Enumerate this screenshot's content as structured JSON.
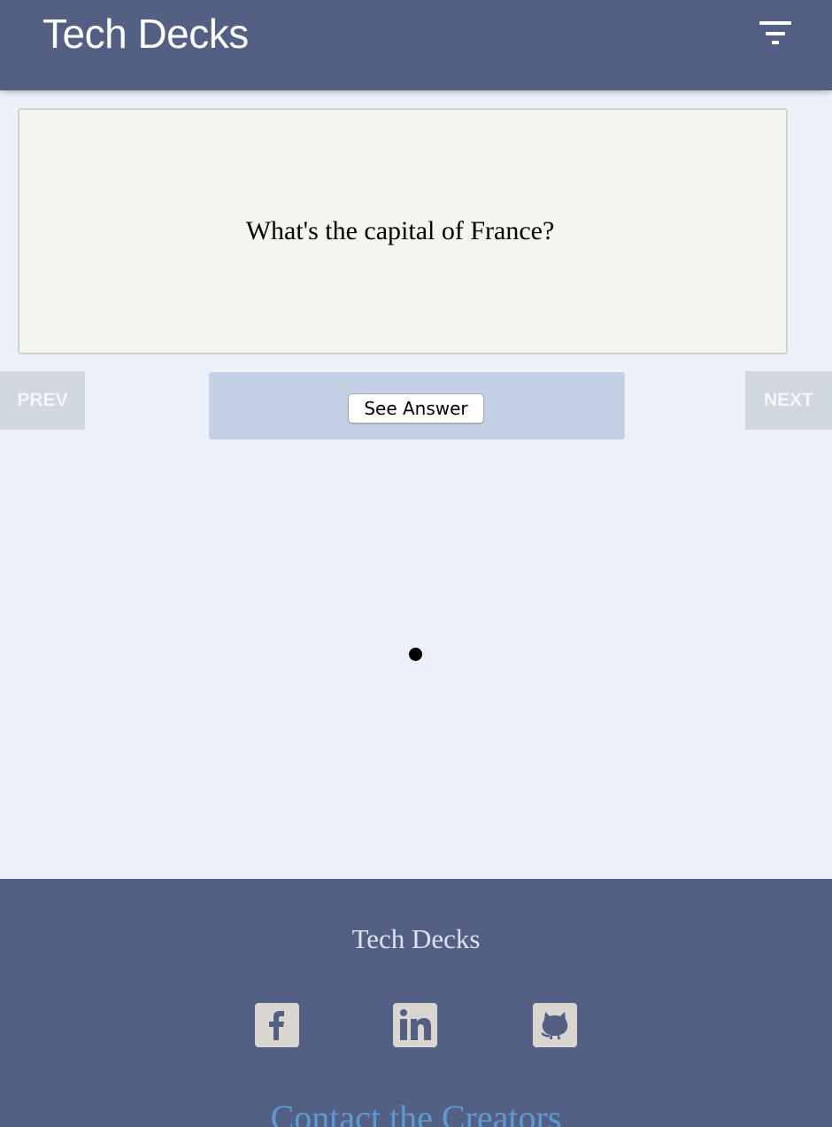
{
  "header": {
    "brand": "Tech Decks",
    "filter_icon": "filter-lines-icon"
  },
  "card": {
    "question": "What's the capital of France?"
  },
  "navigation": {
    "prev_label": "PREV",
    "next_label": "NEXT"
  },
  "answer": {
    "button_label": "See Answer"
  },
  "footer": {
    "title": "Tech Decks",
    "social": [
      {
        "name": "facebook",
        "icon": "facebook-icon"
      },
      {
        "name": "linkedin",
        "icon": "linkedin-icon"
      },
      {
        "name": "github",
        "icon": "github-icon"
      }
    ],
    "contact_label": "Contact the Creators"
  },
  "colors": {
    "header_bg": "#536084",
    "page_bg": "#ecf0f8",
    "card_bg": "#f3f5ef",
    "answer_panel_bg": "#c4d0e3",
    "nav_button_bg": "#d1d7de",
    "social_icon_bg": "#d9d6d0",
    "contact_link": "#5b9bd1"
  }
}
